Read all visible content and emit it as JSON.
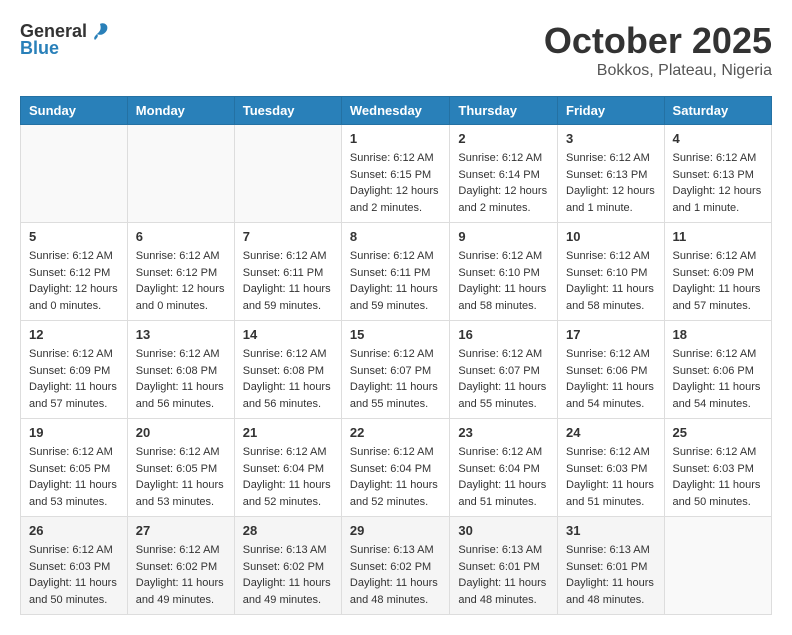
{
  "header": {
    "logo_general": "General",
    "logo_blue": "Blue",
    "month": "October 2025",
    "location": "Bokkos, Plateau, Nigeria"
  },
  "days_of_week": [
    "Sunday",
    "Monday",
    "Tuesday",
    "Wednesday",
    "Thursday",
    "Friday",
    "Saturday"
  ],
  "weeks": [
    [
      {
        "day": "",
        "info": ""
      },
      {
        "day": "",
        "info": ""
      },
      {
        "day": "",
        "info": ""
      },
      {
        "day": "1",
        "info": "Sunrise: 6:12 AM\nSunset: 6:15 PM\nDaylight: 12 hours and 2 minutes."
      },
      {
        "day": "2",
        "info": "Sunrise: 6:12 AM\nSunset: 6:14 PM\nDaylight: 12 hours and 2 minutes."
      },
      {
        "day": "3",
        "info": "Sunrise: 6:12 AM\nSunset: 6:13 PM\nDaylight: 12 hours and 1 minute."
      },
      {
        "day": "4",
        "info": "Sunrise: 6:12 AM\nSunset: 6:13 PM\nDaylight: 12 hours and 1 minute."
      }
    ],
    [
      {
        "day": "5",
        "info": "Sunrise: 6:12 AM\nSunset: 6:12 PM\nDaylight: 12 hours and 0 minutes."
      },
      {
        "day": "6",
        "info": "Sunrise: 6:12 AM\nSunset: 6:12 PM\nDaylight: 12 hours and 0 minutes."
      },
      {
        "day": "7",
        "info": "Sunrise: 6:12 AM\nSunset: 6:11 PM\nDaylight: 11 hours and 59 minutes."
      },
      {
        "day": "8",
        "info": "Sunrise: 6:12 AM\nSunset: 6:11 PM\nDaylight: 11 hours and 59 minutes."
      },
      {
        "day": "9",
        "info": "Sunrise: 6:12 AM\nSunset: 6:10 PM\nDaylight: 11 hours and 58 minutes."
      },
      {
        "day": "10",
        "info": "Sunrise: 6:12 AM\nSunset: 6:10 PM\nDaylight: 11 hours and 58 minutes."
      },
      {
        "day": "11",
        "info": "Sunrise: 6:12 AM\nSunset: 6:09 PM\nDaylight: 11 hours and 57 minutes."
      }
    ],
    [
      {
        "day": "12",
        "info": "Sunrise: 6:12 AM\nSunset: 6:09 PM\nDaylight: 11 hours and 57 minutes."
      },
      {
        "day": "13",
        "info": "Sunrise: 6:12 AM\nSunset: 6:08 PM\nDaylight: 11 hours and 56 minutes."
      },
      {
        "day": "14",
        "info": "Sunrise: 6:12 AM\nSunset: 6:08 PM\nDaylight: 11 hours and 56 minutes."
      },
      {
        "day": "15",
        "info": "Sunrise: 6:12 AM\nSunset: 6:07 PM\nDaylight: 11 hours and 55 minutes."
      },
      {
        "day": "16",
        "info": "Sunrise: 6:12 AM\nSunset: 6:07 PM\nDaylight: 11 hours and 55 minutes."
      },
      {
        "day": "17",
        "info": "Sunrise: 6:12 AM\nSunset: 6:06 PM\nDaylight: 11 hours and 54 minutes."
      },
      {
        "day": "18",
        "info": "Sunrise: 6:12 AM\nSunset: 6:06 PM\nDaylight: 11 hours and 54 minutes."
      }
    ],
    [
      {
        "day": "19",
        "info": "Sunrise: 6:12 AM\nSunset: 6:05 PM\nDaylight: 11 hours and 53 minutes."
      },
      {
        "day": "20",
        "info": "Sunrise: 6:12 AM\nSunset: 6:05 PM\nDaylight: 11 hours and 53 minutes."
      },
      {
        "day": "21",
        "info": "Sunrise: 6:12 AM\nSunset: 6:04 PM\nDaylight: 11 hours and 52 minutes."
      },
      {
        "day": "22",
        "info": "Sunrise: 6:12 AM\nSunset: 6:04 PM\nDaylight: 11 hours and 52 minutes."
      },
      {
        "day": "23",
        "info": "Sunrise: 6:12 AM\nSunset: 6:04 PM\nDaylight: 11 hours and 51 minutes."
      },
      {
        "day": "24",
        "info": "Sunrise: 6:12 AM\nSunset: 6:03 PM\nDaylight: 11 hours and 51 minutes."
      },
      {
        "day": "25",
        "info": "Sunrise: 6:12 AM\nSunset: 6:03 PM\nDaylight: 11 hours and 50 minutes."
      }
    ],
    [
      {
        "day": "26",
        "info": "Sunrise: 6:12 AM\nSunset: 6:03 PM\nDaylight: 11 hours and 50 minutes."
      },
      {
        "day": "27",
        "info": "Sunrise: 6:12 AM\nSunset: 6:02 PM\nDaylight: 11 hours and 49 minutes."
      },
      {
        "day": "28",
        "info": "Sunrise: 6:13 AM\nSunset: 6:02 PM\nDaylight: 11 hours and 49 minutes."
      },
      {
        "day": "29",
        "info": "Sunrise: 6:13 AM\nSunset: 6:02 PM\nDaylight: 11 hours and 48 minutes."
      },
      {
        "day": "30",
        "info": "Sunrise: 6:13 AM\nSunset: 6:01 PM\nDaylight: 11 hours and 48 minutes."
      },
      {
        "day": "31",
        "info": "Sunrise: 6:13 AM\nSunset: 6:01 PM\nDaylight: 11 hours and 48 minutes."
      },
      {
        "day": "",
        "info": ""
      }
    ]
  ]
}
